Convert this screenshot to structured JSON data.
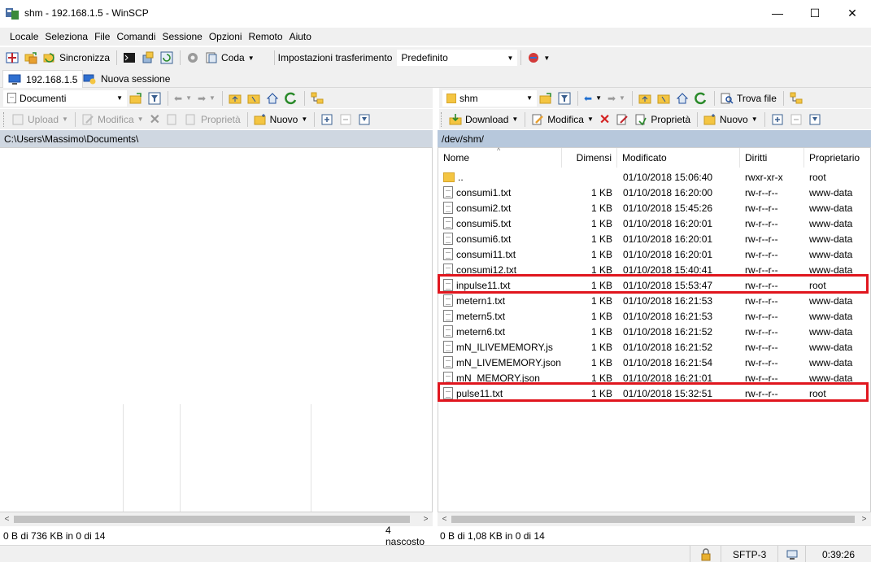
{
  "window": {
    "title": "shm - 192.168.1.5 - WinSCP",
    "minimize": "—",
    "maximize": "☐",
    "close": "✕"
  },
  "menu": [
    "Locale",
    "Seleziona",
    "File",
    "Comandi",
    "Sessione",
    "Opzioni",
    "Remoto",
    "Aiuto"
  ],
  "main_toolbar": {
    "sync_label": "Sincronizza",
    "queue_label": "Coda",
    "transfer_settings_label": "Impostazioni trasferimento",
    "transfer_settings_value": "Predefinito"
  },
  "session_tabs": {
    "active": "192.168.1.5",
    "new_session": "Nuova sessione"
  },
  "left_panel": {
    "location": "Documenti",
    "actions": {
      "upload": "Upload",
      "edit": "Modifica",
      "properties": "Proprietà",
      "new": "Nuovo"
    },
    "path": "C:\\Users\\Massimo\\Documents\\",
    "status": "0 B di 736 KB in 0 di 14",
    "hidden": "4 nascosto"
  },
  "right_panel": {
    "location": "shm",
    "find_files": "Trova file",
    "actions": {
      "download": "Download",
      "edit": "Modifica",
      "properties": "Proprietà",
      "new": "Nuovo"
    },
    "path": "/dev/shm/",
    "columns": [
      "Nome",
      "Dimensi",
      "Modificato",
      "Diritti",
      "Proprietario"
    ],
    "rows": [
      {
        "name": "..",
        "size": "",
        "modified": "01/10/2018 15:06:40",
        "rights": "rwxr-xr-x",
        "owner": "root",
        "type": "parent"
      },
      {
        "name": "consumi1.txt",
        "size": "1 KB",
        "modified": "01/10/2018 16:20:00",
        "rights": "rw-r--r--",
        "owner": "www-data",
        "type": "file"
      },
      {
        "name": "consumi2.txt",
        "size": "1 KB",
        "modified": "01/10/2018 15:45:26",
        "rights": "rw-r--r--",
        "owner": "www-data",
        "type": "file"
      },
      {
        "name": "consumi5.txt",
        "size": "1 KB",
        "modified": "01/10/2018 16:20:01",
        "rights": "rw-r--r--",
        "owner": "www-data",
        "type": "file"
      },
      {
        "name": "consumi6.txt",
        "size": "1 KB",
        "modified": "01/10/2018 16:20:01",
        "rights": "rw-r--r--",
        "owner": "www-data",
        "type": "file"
      },
      {
        "name": "consumi11.txt",
        "size": "1 KB",
        "modified": "01/10/2018 16:20:01",
        "rights": "rw-r--r--",
        "owner": "www-data",
        "type": "file"
      },
      {
        "name": "consumi12.txt",
        "size": "1 KB",
        "modified": "01/10/2018 15:40:41",
        "rights": "rw-r--r--",
        "owner": "www-data",
        "type": "file"
      },
      {
        "name": "inpulse11.txt",
        "size": "1 KB",
        "modified": "01/10/2018 15:53:47",
        "rights": "rw-r--r--",
        "owner": "root",
        "type": "file",
        "highlight": true
      },
      {
        "name": "metern1.txt",
        "size": "1 KB",
        "modified": "01/10/2018 16:21:53",
        "rights": "rw-r--r--",
        "owner": "www-data",
        "type": "file"
      },
      {
        "name": "metern5.txt",
        "size": "1 KB",
        "modified": "01/10/2018 16:21:53",
        "rights": "rw-r--r--",
        "owner": "www-data",
        "type": "file"
      },
      {
        "name": "metern6.txt",
        "size": "1 KB",
        "modified": "01/10/2018 16:21:52",
        "rights": "rw-r--r--",
        "owner": "www-data",
        "type": "file"
      },
      {
        "name": "mN_ILIVEMEMORY.js",
        "size": "1 KB",
        "modified": "01/10/2018 16:21:52",
        "rights": "rw-r--r--",
        "owner": "www-data",
        "type": "file"
      },
      {
        "name": "mN_LIVEMEMORY.json",
        "size": "1 KB",
        "modified": "01/10/2018 16:21:54",
        "rights": "rw-r--r--",
        "owner": "www-data",
        "type": "file"
      },
      {
        "name": "mN_MEMORY.json",
        "size": "1 KB",
        "modified": "01/10/2018 16:21:01",
        "rights": "rw-r--r--",
        "owner": "www-data",
        "type": "file"
      },
      {
        "name": "pulse11.txt",
        "size": "1 KB",
        "modified": "01/10/2018 15:32:51",
        "rights": "rw-r--r--",
        "owner": "root",
        "type": "file",
        "highlight": true
      }
    ],
    "status": "0 B di 1,08 KB in 0 di 14"
  },
  "bottom_status": {
    "protocol": "SFTP-3",
    "time": "0:39:26"
  },
  "colors": {
    "highlight": "#e0161e",
    "path_active": "#b7c8dc"
  }
}
